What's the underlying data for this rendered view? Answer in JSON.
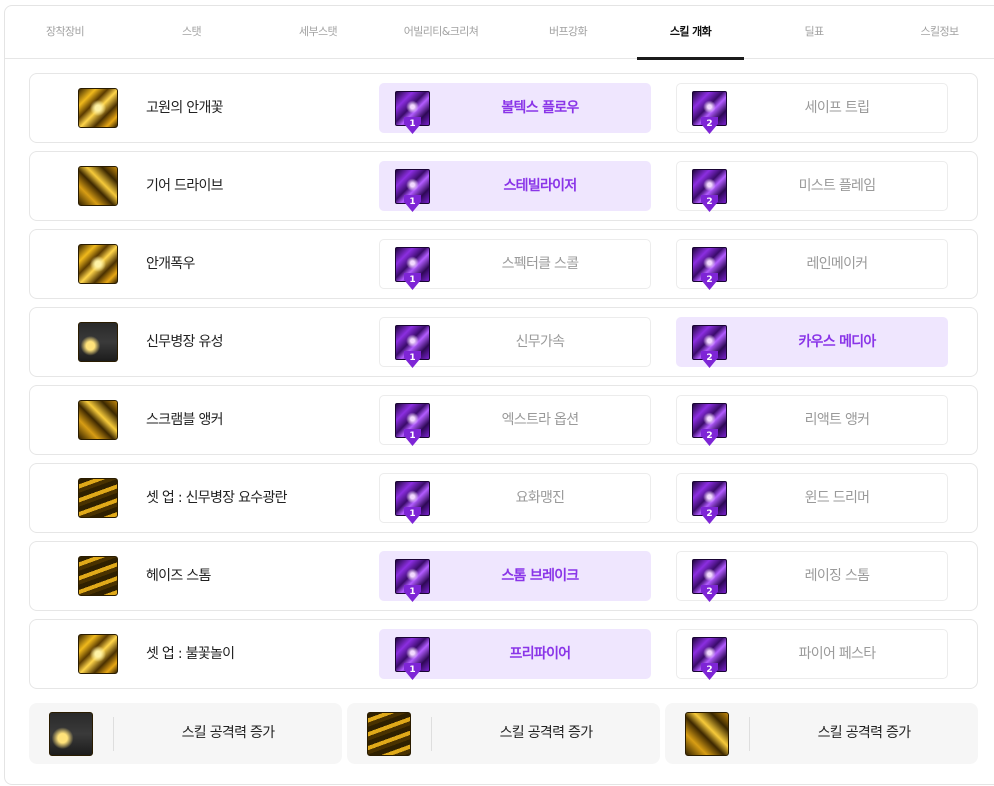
{
  "tabs": [
    {
      "label": "장착장비"
    },
    {
      "label": "스탯"
    },
    {
      "label": "세부스탯"
    },
    {
      "label": "어빌리티&크리쳐"
    },
    {
      "label": "버프강화"
    },
    {
      "label": "스킬 개화"
    },
    {
      "label": "딜표"
    },
    {
      "label": "스킬정보"
    }
  ],
  "active_tab": "스킬 개화",
  "skills": [
    {
      "name": "고원의 안개꽃",
      "opt1": "볼텍스 플로우",
      "opt2": "세이프 트립",
      "selected": 1
    },
    {
      "name": "기어 드라이브",
      "opt1": "스테빌라이저",
      "opt2": "미스트 플레임",
      "selected": 1
    },
    {
      "name": "안개폭우",
      "opt1": "스펙터클 스콜",
      "opt2": "레인메이커",
      "selected": 0
    },
    {
      "name": "신무병장 유성",
      "opt1": "신무가속",
      "opt2": "카우스 메디아",
      "selected": 2
    },
    {
      "name": "스크램블 앵커",
      "opt1": "엑스트라 옵션",
      "opt2": "리액트 앵커",
      "selected": 0
    },
    {
      "name": "셋 업 : 신무병장 요수광란",
      "opt1": "요화맹진",
      "opt2": "윈드 드리머",
      "selected": 0
    },
    {
      "name": "헤이즈 스톰",
      "opt1": "스톰 브레이크",
      "opt2": "레이징 스톰",
      "selected": 1
    },
    {
      "name": "셋 업 : 불꽃놀이",
      "opt1": "프리파이어",
      "opt2": "파이어 페스타",
      "selected": 1
    }
  ],
  "badge_labels": [
    "1",
    "2"
  ],
  "bonuses": [
    {
      "label": "스킬 공격력 증가"
    },
    {
      "label": "스킬 공격력 증가"
    },
    {
      "label": "스킬 공격력 증가"
    }
  ],
  "colors": {
    "accent_purple": "#8a35e8",
    "selected_bg": "#efe6fe",
    "badge_purple": "#7e25d6"
  },
  "icons": {
    "skill_icon": "gold-skill-icon",
    "choice_icon": "purple-skill-icon"
  }
}
